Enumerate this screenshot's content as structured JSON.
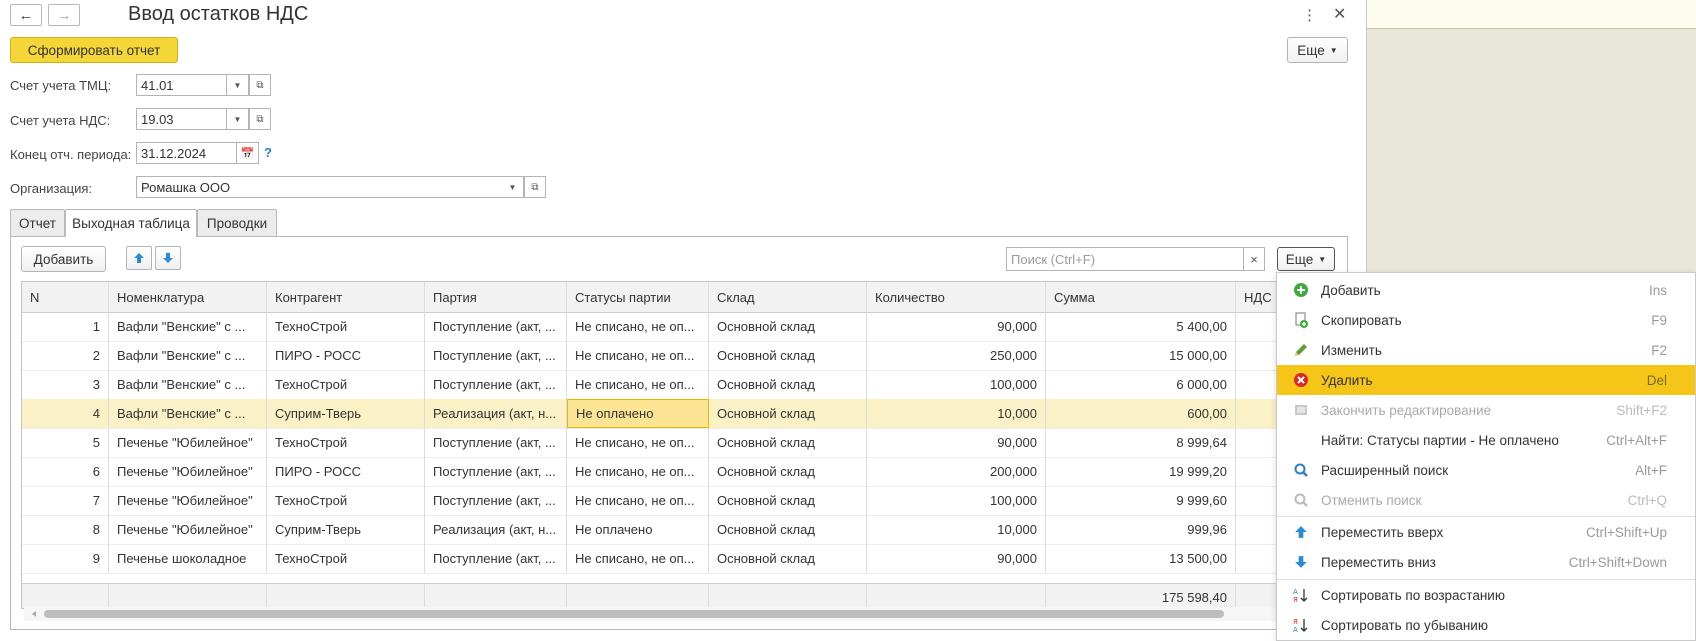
{
  "window": {
    "title": "Ввод остатков НДС"
  },
  "toolbar": {
    "generate_label": "Сформировать отчет",
    "more_label": "Еще"
  },
  "form": {
    "tmc_label": "Счет учета ТМЦ:",
    "tmc_value": "41.01",
    "vat_label": "Счет учета НДС:",
    "vat_value": "19.03",
    "period_label": "Конец отч. периода:",
    "period_value": "31.12.2024",
    "org_label": "Организация:",
    "org_value": "Ромашка ООО",
    "help": "?"
  },
  "tabs": [
    {
      "label": "Отчет"
    },
    {
      "label": "Выходная таблица"
    },
    {
      "label": "Проводки"
    }
  ],
  "table_toolbar": {
    "add_label": "Добавить",
    "search_placeholder": "Поиск (Ctrl+F)",
    "clear": "×",
    "more_label": "Еще"
  },
  "table": {
    "columns": [
      "N",
      "Номенклатура",
      "Контрагент",
      "Партия",
      "Статусы партии",
      "Склад",
      "Количество",
      "Сумма",
      "НДС"
    ],
    "rows": [
      {
        "n": "1",
        "item": "Вафли \"Венские\" с ...",
        "partner": "ТехноСтрой",
        "batch": "Поступление (акт, ...",
        "status": "Не списано, не оп...",
        "store": "Основной склад",
        "qty": "90,000",
        "sum": "5 400,00"
      },
      {
        "n": "2",
        "item": "Вафли \"Венские\" с ...",
        "partner": "ПИРО - РОСС",
        "batch": "Поступление (акт, ...",
        "status": "Не списано, не оп...",
        "store": "Основной склад",
        "qty": "250,000",
        "sum": "15 000,00"
      },
      {
        "n": "3",
        "item": "Вафли \"Венские\" с ...",
        "partner": "ТехноСтрой",
        "batch": "Поступление (акт, ...",
        "status": "Не списано, не оп...",
        "store": "Основной склад",
        "qty": "100,000",
        "sum": "6 000,00"
      },
      {
        "n": "4",
        "item": "Вафли \"Венские\" с ...",
        "partner": "Суприм-Тверь",
        "batch": "Реализация (акт, н...",
        "status": "Не оплачено",
        "store": "Основной склад",
        "qty": "10,000",
        "sum": "600,00"
      },
      {
        "n": "5",
        "item": "Печенье \"Юбилейное\"",
        "partner": "ТехноСтрой",
        "batch": "Поступление (акт, ...",
        "status": "Не списано, не оп...",
        "store": "Основной склад",
        "qty": "90,000",
        "sum": "8 999,64"
      },
      {
        "n": "6",
        "item": "Печенье \"Юбилейное\"",
        "partner": "ПИРО - РОСС",
        "batch": "Поступление (акт, ...",
        "status": "Не списано, не оп...",
        "store": "Основной склад",
        "qty": "200,000",
        "sum": "19 999,20"
      },
      {
        "n": "7",
        "item": "Печенье \"Юбилейное\"",
        "partner": "ТехноСтрой",
        "batch": "Поступление (акт, ...",
        "status": "Не списано, не оп...",
        "store": "Основной склад",
        "qty": "100,000",
        "sum": "9 999,60"
      },
      {
        "n": "8",
        "item": "Печенье \"Юбилейное\"",
        "partner": "Суприм-Тверь",
        "batch": "Реализация (акт, н...",
        "status": "Не оплачено",
        "store": "Основной склад",
        "qty": "10,000",
        "sum": "999,96"
      },
      {
        "n": "9",
        "item": "Печенье шоколадное",
        "partner": "ТехноСтрой",
        "batch": "Поступление (акт, ...",
        "status": "Не списано, не оп...",
        "store": "Основной склад",
        "qty": "90,000",
        "sum": "13 500,00"
      }
    ],
    "total_sum": "175 598,40"
  },
  "context_menu": {
    "items": [
      {
        "label": "Добавить",
        "shortcut": "Ins",
        "icon": "plus-circle-icon"
      },
      {
        "label": "Скопировать",
        "shortcut": "F9",
        "icon": "copy-icon"
      },
      {
        "label": "Изменить",
        "shortcut": "F2",
        "icon": "pencil-icon"
      },
      {
        "label": "Удалить",
        "shortcut": "Del",
        "icon": "delete-circle-icon"
      },
      {
        "label": "Закончить редактирование",
        "shortcut": "Shift+F2",
        "icon": "end-edit-icon"
      },
      {
        "label": "Найти: Статусы партии - Не оплачено",
        "shortcut": "Ctrl+Alt+F",
        "icon": ""
      },
      {
        "label": "Расширенный поиск",
        "shortcut": "Alt+F",
        "icon": "magnifier-icon"
      },
      {
        "label": "Отменить поиск",
        "shortcut": "Ctrl+Q",
        "icon": "cancel-search-icon"
      },
      {
        "label": "Переместить вверх",
        "shortcut": "Ctrl+Shift+Up",
        "icon": "arrow-up-icon"
      },
      {
        "label": "Переместить вниз",
        "shortcut": "Ctrl+Shift+Down",
        "icon": "arrow-down-icon"
      },
      {
        "label": "Сортировать по возрастанию",
        "shortcut": "",
        "icon": "sort-asc-icon"
      },
      {
        "label": "Сортировать по убыванию",
        "shortcut": "",
        "icon": "sort-desc-icon"
      }
    ]
  },
  "colors": {
    "accent_yellow": "#f5d638",
    "menu_highlight": "#f5c518",
    "selected_row": "#fbf1c7",
    "link_blue": "#2a7fc5"
  }
}
